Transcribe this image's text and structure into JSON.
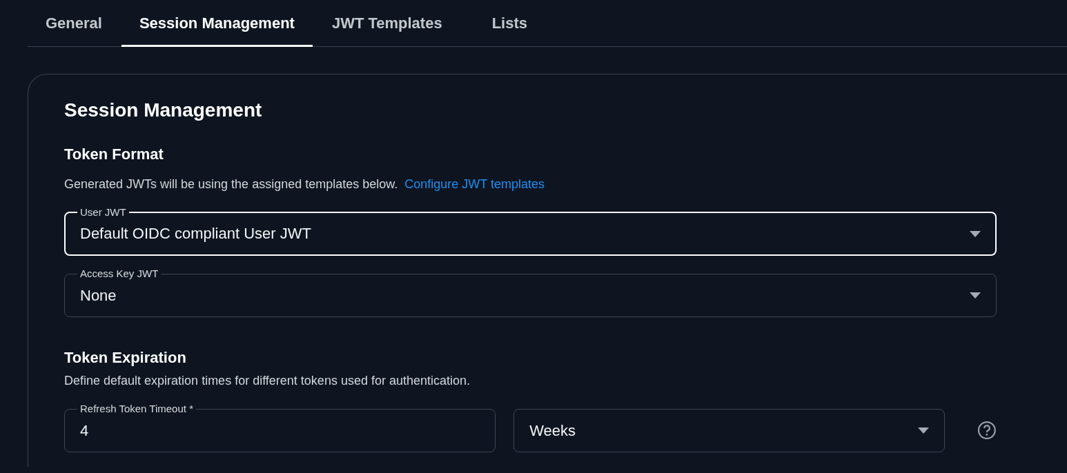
{
  "tabs": [
    {
      "label": "General",
      "selected": false
    },
    {
      "label": "Session Management",
      "selected": true
    },
    {
      "label": "JWT Templates",
      "selected": false
    },
    {
      "label": "Lists",
      "selected": false
    }
  ],
  "card": {
    "title": "Session Management",
    "token_format": {
      "title": "Token Format",
      "description": "Generated JWTs will be using the assigned templates below.",
      "link": "Configure JWT templates",
      "fields": [
        {
          "kind": "select",
          "label": "User JWT",
          "value": "Default OIDC compliant User JWT",
          "focused": true
        },
        {
          "kind": "select",
          "label": "Access Key JWT",
          "value": "None",
          "focused": false
        }
      ]
    },
    "token_expiration": {
      "title": "Token Expiration",
      "description": "Define default expiration times for different tokens used for authentication.",
      "fields": [
        {
          "kind": "text",
          "label": "Refresh Token Timeout *",
          "value": "4",
          "focused": false
        },
        {
          "kind": "select",
          "value": "Weeks",
          "focused": false
        }
      ]
    }
  }
}
